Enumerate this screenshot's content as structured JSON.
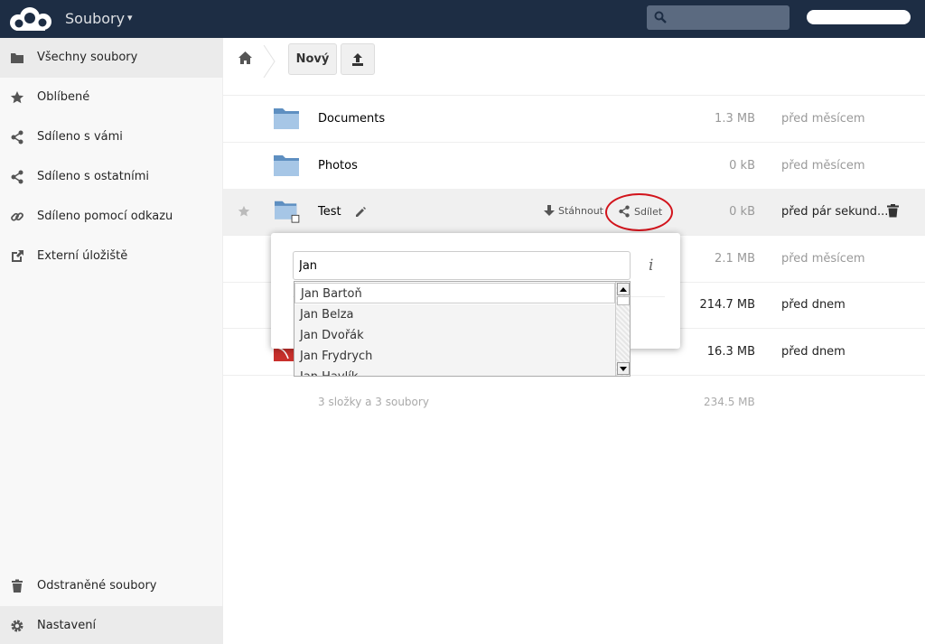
{
  "header": {
    "app_title": "Soubory",
    "app_caret": "▾",
    "search": {
      "placeholder": "",
      "value": ""
    },
    "colors": {
      "background": "#1d2d44",
      "search_bg": "#5b6a80"
    }
  },
  "sidebar": {
    "items": [
      {
        "label": "Všechny soubory",
        "icon": "folder-icon",
        "active": true
      },
      {
        "label": "Oblíbené",
        "icon": "star-icon"
      },
      {
        "label": "Sdíleno s vámi",
        "icon": "share-icon"
      },
      {
        "label": "Sdíleno s ostatními",
        "icon": "share-icon"
      },
      {
        "label": "Sdíleno pomocí odkazu",
        "icon": "link-icon"
      },
      {
        "label": "Externí úložiště",
        "icon": "external-storage-icon"
      }
    ],
    "bottom_items": [
      {
        "label": "Odstraněné soubory",
        "icon": "trash-icon"
      },
      {
        "label": "Nastavení",
        "icon": "gear-icon"
      }
    ]
  },
  "controls": {
    "new_button": "Nový",
    "upload_button_icon": "upload-icon"
  },
  "files": [
    {
      "name": "Documents",
      "size": "1.3 MB",
      "modified": "před měsícem"
    },
    {
      "name": "Photos",
      "size": "0 kB",
      "modified": "před měsícem"
    },
    {
      "name": "Test",
      "size": "0 kB",
      "modified": "před pár sekund...",
      "download_label": "Stáhnout",
      "share_label": "Sdílet"
    },
    {
      "name": "",
      "size": "2.1 MB",
      "modified": "před měsícem"
    },
    {
      "name": "",
      "size": "214.7 MB",
      "modified": "před dnem"
    },
    {
      "name": "",
      "size": "16.3 MB",
      "modified": "před dnem"
    }
  ],
  "summary": {
    "counts": "3 složky a 3 soubory",
    "total_size": "234.5 MB"
  },
  "share": {
    "input_value": "Jan",
    "info_icon": "i",
    "suggestions": [
      "Jan Bartoň",
      "Jan Belza",
      "Jan Dvořák",
      "Jan Frydrych",
      "Jan Havlík"
    ]
  },
  "colors": {
    "highlight_circle": "#d2141c",
    "selected_row": "#f0f0f0"
  }
}
